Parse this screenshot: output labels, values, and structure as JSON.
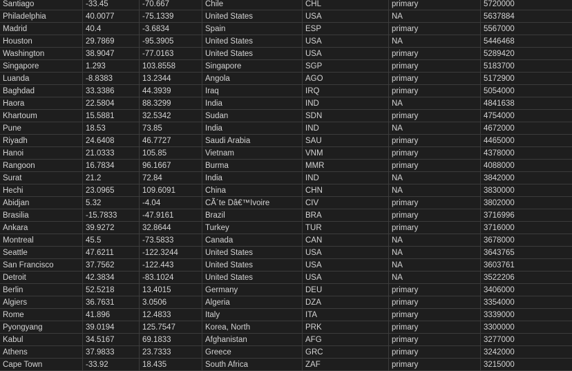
{
  "table": {
    "rows": [
      [
        "Santiago",
        "-33.45",
        "-70.667",
        "Chile",
        "CHL",
        "primary",
        "5720000"
      ],
      [
        "Philadelphia",
        "40.0077",
        "-75.1339",
        "United States",
        "USA",
        "NA",
        "5637884"
      ],
      [
        "Madrid",
        "40.4",
        "-3.6834",
        "Spain",
        "ESP",
        "primary",
        "5567000"
      ],
      [
        "Houston",
        "29.7869",
        "-95.3905",
        "United States",
        "USA",
        "NA",
        "5446468"
      ],
      [
        "Washington",
        "38.9047",
        "-77.0163",
        "United States",
        "USA",
        "primary",
        "5289420"
      ],
      [
        "Singapore",
        "1.293",
        "103.8558",
        "Singapore",
        "SGP",
        "primary",
        "5183700"
      ],
      [
        "Luanda",
        "-8.8383",
        "13.2344",
        "Angola",
        "AGO",
        "primary",
        "5172900"
      ],
      [
        "Baghdad",
        "33.3386",
        "44.3939",
        "Iraq",
        "IRQ",
        "primary",
        "5054000"
      ],
      [
        "Haora",
        "22.5804",
        "88.3299",
        "India",
        "IND",
        "NA",
        "4841638"
      ],
      [
        "Khartoum",
        "15.5881",
        "32.5342",
        "Sudan",
        "SDN",
        "primary",
        "4754000"
      ],
      [
        "Pune",
        "18.53",
        "73.85",
        "India",
        "IND",
        "NA",
        "4672000"
      ],
      [
        "Riyadh",
        "24.6408",
        "46.7727",
        "Saudi Arabia",
        "SAU",
        "primary",
        "4465000"
      ],
      [
        "Hanoi",
        "21.0333",
        "105.85",
        "Vietnam",
        "VNM",
        "primary",
        "4378000"
      ],
      [
        "Rangoon",
        "16.7834",
        "96.1667",
        "Burma",
        "MMR",
        "primary",
        "4088000"
      ],
      [
        "Surat",
        "21.2",
        "72.84",
        "India",
        "IND",
        "NA",
        "3842000"
      ],
      [
        "Hechi",
        "23.0965",
        "109.6091",
        "China",
        "CHN",
        "NA",
        "3830000"
      ],
      [
        "Abidjan",
        "5.32",
        "-4.04",
        "CÃ´te Dâ€™Ivoire",
        "CIV",
        "primary",
        "3802000"
      ],
      [
        "Brasilia",
        "-15.7833",
        "-47.9161",
        "Brazil",
        "BRA",
        "primary",
        "3716996"
      ],
      [
        "Ankara",
        "39.9272",
        "32.8644",
        "Turkey",
        "TUR",
        "primary",
        "3716000"
      ],
      [
        "Montreal",
        "45.5",
        "-73.5833",
        "Canada",
        "CAN",
        "NA",
        "3678000"
      ],
      [
        "Seattle",
        "47.6211",
        "-122.3244",
        "United States",
        "USA",
        "NA",
        "3643765"
      ],
      [
        "San Francisco",
        "37.7562",
        "-122.443",
        "United States",
        "USA",
        "NA",
        "3603761"
      ],
      [
        "Detroit",
        "42.3834",
        "-83.1024",
        "United States",
        "USA",
        "NA",
        "3522206"
      ],
      [
        "Berlin",
        "52.5218",
        "13.4015",
        "Germany",
        "DEU",
        "primary",
        "3406000"
      ],
      [
        "Algiers",
        "36.7631",
        "3.0506",
        "Algeria",
        "DZA",
        "primary",
        "3354000"
      ],
      [
        "Rome",
        "41.896",
        "12.4833",
        "Italy",
        "ITA",
        "primary",
        "3339000"
      ],
      [
        "Pyongyang",
        "39.0194",
        "125.7547",
        "Korea, North",
        "PRK",
        "primary",
        "3300000"
      ],
      [
        "Kabul",
        "34.5167",
        "69.1833",
        "Afghanistan",
        "AFG",
        "primary",
        "3277000"
      ],
      [
        "Athens",
        "37.9833",
        "23.7333",
        "Greece",
        "GRC",
        "primary",
        "3242000"
      ],
      [
        "Cape Town",
        "-33.92",
        "18.435",
        "South Africa",
        "ZAF",
        "primary",
        "3215000"
      ]
    ]
  }
}
